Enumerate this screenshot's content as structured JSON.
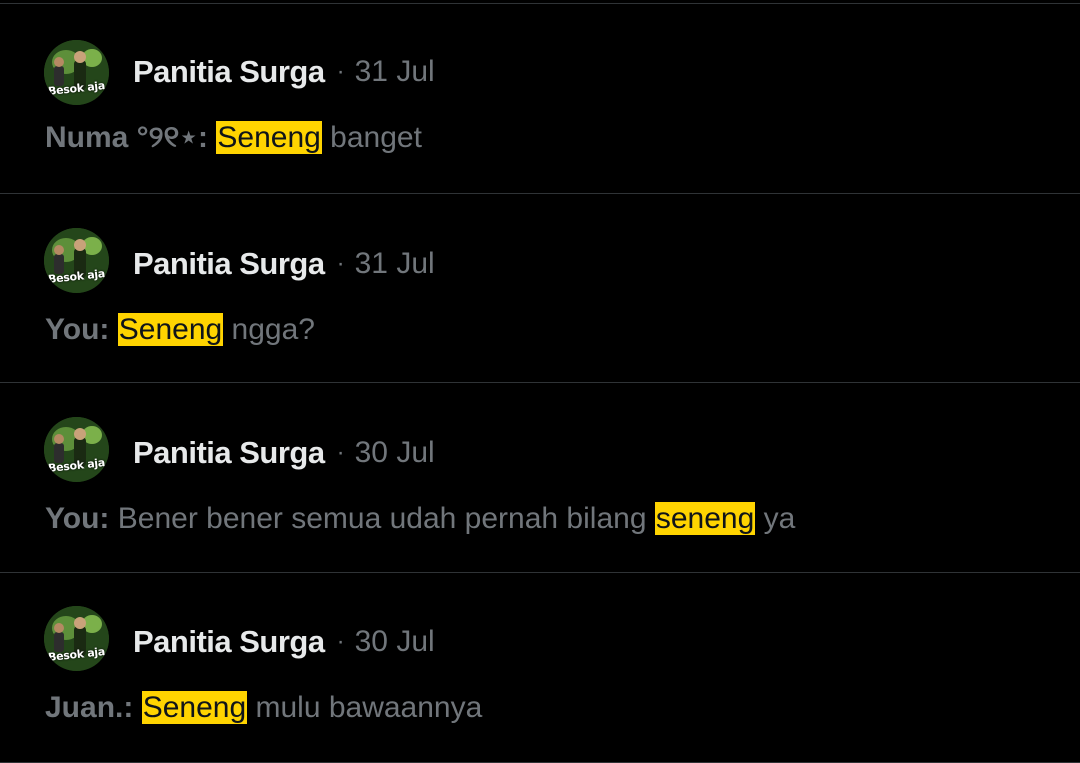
{
  "results": [
    {
      "avatar_caption": "Besok aja",
      "name": "Panitia Surga",
      "separator": "·",
      "date": "31 Jul",
      "sender": "Numa °୨୧⋆:",
      "before": "",
      "highlight": "Seneng",
      "after": " banget"
    },
    {
      "avatar_caption": "Besok aja",
      "name": "Panitia Surga",
      "separator": "·",
      "date": "31 Jul",
      "sender": "You:",
      "before": "",
      "highlight": "Seneng",
      "after": " ngga?"
    },
    {
      "avatar_caption": "Besok aja",
      "name": "Panitia Surga",
      "separator": "·",
      "date": "30 Jul",
      "sender": "You:",
      "before": "Bener bener semua udah pernah bilang ",
      "highlight": "seneng",
      "after": " ya"
    },
    {
      "avatar_caption": "Besok aja",
      "name": "Panitia Surga",
      "separator": "·",
      "date": "30 Jul",
      "sender": "Juan.:",
      "before": "",
      "highlight": "Seneng",
      "after": " mulu bawaannya"
    }
  ],
  "colors": {
    "background": "#000000",
    "divider": "#2f3336",
    "primary_text": "#e7e9ea",
    "secondary_text": "#71767b",
    "highlight": "#ffd400"
  }
}
